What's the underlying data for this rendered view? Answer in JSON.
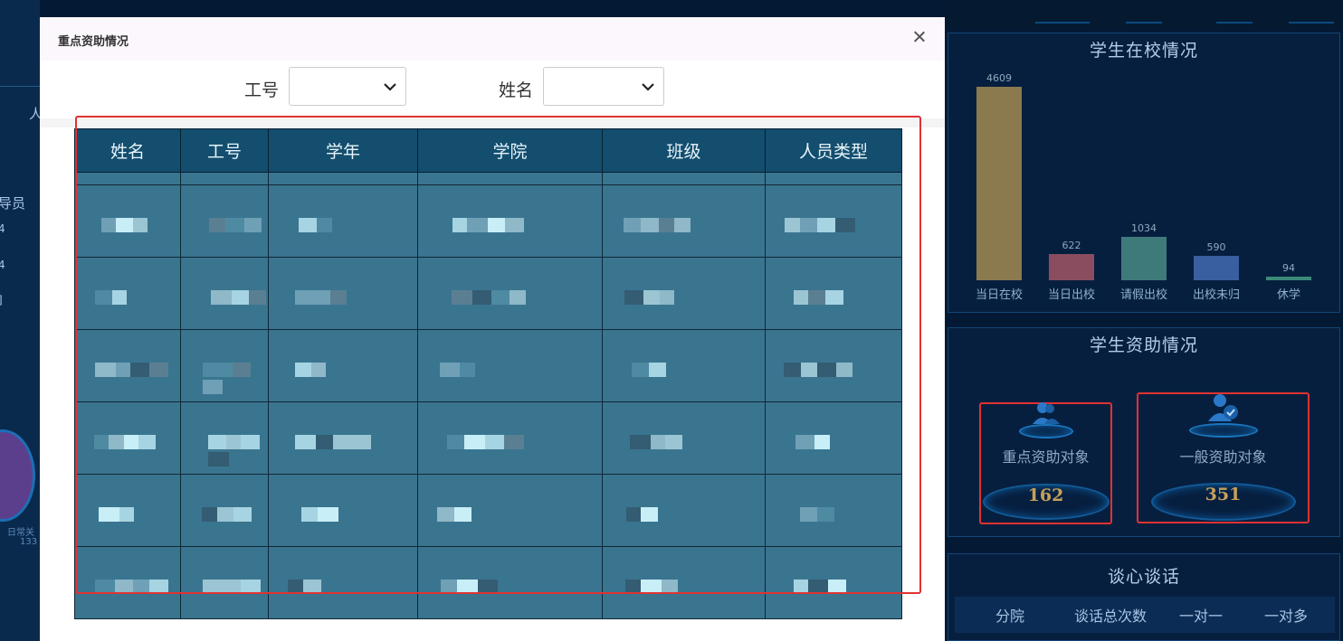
{
  "modal": {
    "title": "重点资助情况",
    "filters": [
      {
        "label": "工号",
        "value": ""
      },
      {
        "label": "姓名",
        "value": ""
      }
    ],
    "table": {
      "headers": [
        "姓名",
        "工号",
        "学年",
        "学院",
        "班级",
        "人员类型"
      ],
      "row_count": 6
    }
  },
  "right": {
    "panel1": {
      "title": "学生在校情况",
      "chart_data": {
        "type": "bar",
        "categories": [
          "当日在校",
          "当日出校",
          "请假出校",
          "出校未归",
          "休学"
        ],
        "values": [
          4609,
          622,
          1034,
          590,
          94
        ],
        "colors": [
          "#8a7a4e",
          "#8a4d5f",
          "#3f7a7a",
          "#3a5fa0",
          "#3c8a78"
        ],
        "ylim": [
          0,
          4609
        ]
      }
    },
    "panel2": {
      "title": "学生资助情况",
      "key_label": "重点资助对象",
      "key_value": "162",
      "general_label": "一般资助对象",
      "general_value": "351"
    },
    "panel3": {
      "title": "谈心谈话",
      "columns": [
        "分院",
        "谈话总次数",
        "一对一",
        "一对多"
      ]
    }
  },
  "left": {
    "labels": [
      "人",
      "导员",
      "4",
      "4",
      "]"
    ],
    "circle_label": "日常关",
    "circle_value": "133"
  }
}
